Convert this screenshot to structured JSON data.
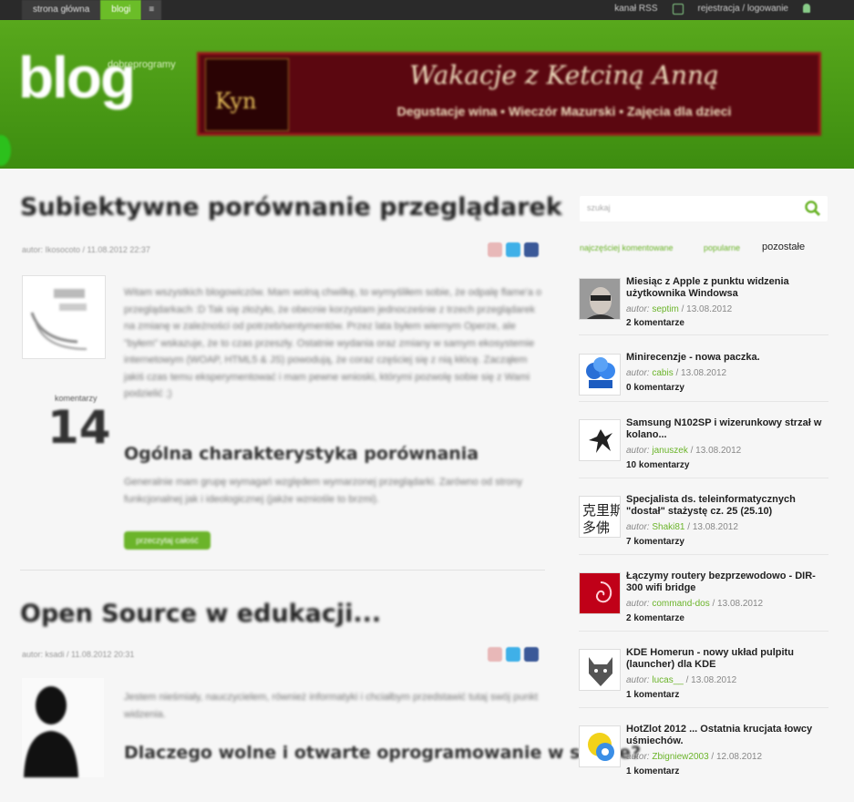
{
  "topbar": {
    "nav": [
      "strona główna",
      "blogi",
      "≡"
    ],
    "links": [
      "kanał RSS",
      "rejestracja / logowanie"
    ]
  },
  "header": {
    "logo_big": "blog",
    "logo_small": "dobreprogramy",
    "banner_title": "Wakacje z Ketciną Anną",
    "banner_subtitle": "Degustacje wina • Wieczór Mazurski • Zajęcia dla dzieci",
    "banner_left_text": "Kyn"
  },
  "posts": [
    {
      "title": "Subiektywne porównanie przeglądarek",
      "meta": "autor: Ikosocoto / 11.08.2012 22:37",
      "paragraph": "Witam wszystkich blogowiczów. Mam wolną chwilkę, to wymyśliłem sobie, że odpalę flame'a o przeglądarkach :D Tak się złożyło, że obecnie korzystam jednocześnie z trzech przeglądarek na zmianę w zależności od potrzeb/sentymentów. Przez lata byłem wiernym Operze, ale \"byłem\" wskazuje, że to czas przeszły. Ostatnie wydania oraz zmiany w samym ekosystemie internetowym (WOAP, HTML5 & JS) powodują, że coraz częściej się z nią kłócę. Zacząłem jakiś czas temu eksperymentować i mam pewne wnioski, którymi pozwolę sobie się z Wami podzielić ;)",
      "comments_label": "komentarzy",
      "comments_count": "14",
      "subheading": "Ogólna charakterystyka porównania",
      "subparagraph": "Generalnie mam grupę wymagań względem wymarzonej przeglądarki. Zarówno od strony funkcjonalnej jak i ideologicznej (jakże wzniośle to brzmi).",
      "button": "przeczytaj całość"
    },
    {
      "title": "Open Source w edukacji...",
      "meta": "autor: ksadi / 11.08.2012 20:31",
      "paragraph": "Jestem nieśmiały, nauczycielem, również informatyki i chciałbym przedstawić tutaj swój punkt widzenia.",
      "subheading": "Dlaczego wolne i otwarte oprogramowanie w szkole?"
    }
  ],
  "sidebar": {
    "search_placeholder": "szukaj",
    "tabs": [
      "najczęściej komentowane",
      "popularne",
      "pozostałe"
    ],
    "items": [
      {
        "title": "Miesiąc z Apple z punktu widzenia użytkownika Windowsa",
        "author_label": "autor:",
        "author": "septim",
        "date": "/ 13.08.2012",
        "comments": "2 komentarze"
      },
      {
        "title": "Minirecenzje - nowa paczka.",
        "author_label": "autor:",
        "author": "cabis",
        "date": "/ 13.08.2012",
        "comments": "0 komentarzy"
      },
      {
        "title": "Samsung N102SP i wizerunkowy strzał w kolano...",
        "author_label": "autor:",
        "author": "januszek",
        "date": "/ 13.08.2012",
        "comments": "10 komentarzy"
      },
      {
        "title": "Specjalista ds. teleinformatycznych \"dostał\" stażystę cz. 25 (25.10)",
        "author_label": "autor:",
        "author": "Shaki81",
        "date": "/ 13.08.2012",
        "comments": "7 komentarzy"
      },
      {
        "title": "Łączymy routery bezprzewodowo - DIR-300 wifi bridge",
        "author_label": "autor:",
        "author": "command-dos",
        "date": "/ 13.08.2012",
        "comments": "2 komentarze"
      },
      {
        "title": "KDE Homerun - nowy układ pulpitu (launcher) dla KDE",
        "author_label": "autor:",
        "author": "lucas__",
        "date": "/ 13.08.2012",
        "comments": "1 komentarz"
      },
      {
        "title": "HotZlot 2012 ... Ostatnia krucjata łowcy uśmiechów.",
        "author_label": "autor:",
        "author": "Zbigniew2003",
        "date": "/ 12.08.2012",
        "comments": "1 komentarz"
      }
    ]
  }
}
